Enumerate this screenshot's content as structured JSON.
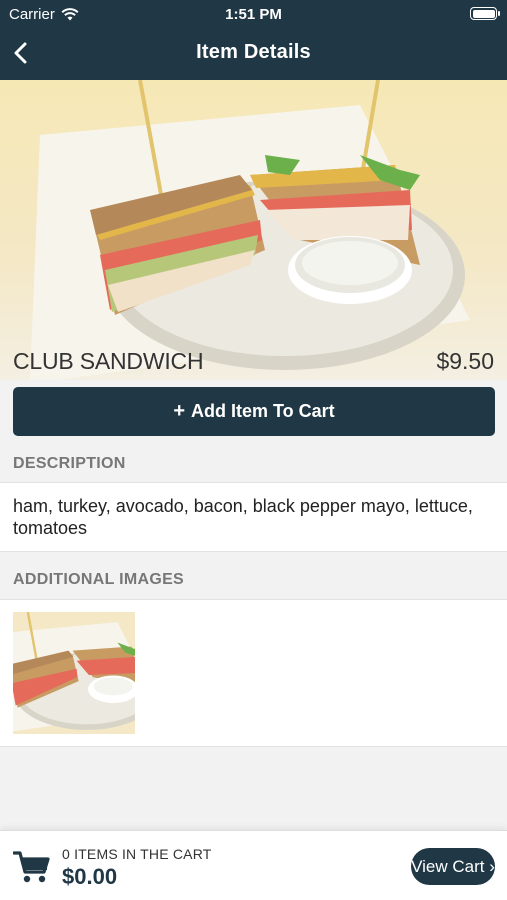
{
  "status_bar": {
    "carrier": "Carrier",
    "time": "1:51 PM"
  },
  "nav": {
    "title": "Item Details"
  },
  "item": {
    "name": "CLUB SANDWICH",
    "price": "$9.50",
    "add_to_cart_label": "Add Item To Cart",
    "description": "ham, turkey, avocado, bacon, black pepper mayo, lettuce, tomatoes"
  },
  "sections": {
    "description_header": "DESCRIPTION",
    "additional_images_header": "ADDITIONAL IMAGES"
  },
  "cart": {
    "items_label": "0 ITEMS IN THE CART",
    "total": "$0.00",
    "view_cart_label": "View Cart ›"
  },
  "colors": {
    "brand": "#203745",
    "section_bg": "#f2f2f2",
    "header_text": "#777777"
  },
  "icons": [
    "wifi-icon",
    "battery-icon",
    "back-chevron-icon",
    "plus-icon",
    "cart-icon"
  ]
}
